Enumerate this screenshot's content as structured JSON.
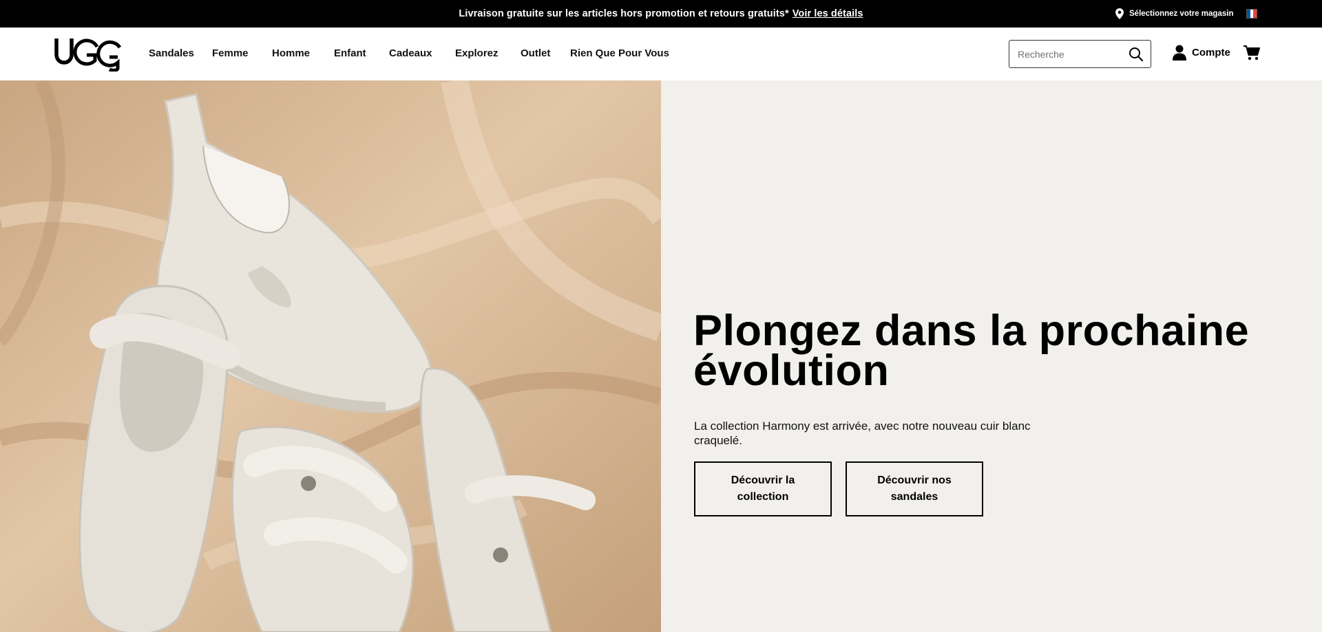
{
  "promo": {
    "message": "Livraison gratuite sur les articles hors promotion et retours gratuits*",
    "link": "Voir les détails",
    "store": "Sélectionnez votre magasin",
    "country_flag_colors": [
      "#0055a4",
      "#ffffff",
      "#ef4135"
    ]
  },
  "header": {
    "brand": "UGG",
    "nav": [
      {
        "label": "Sandales"
      },
      {
        "label": "Femme"
      },
      {
        "label": "Homme"
      },
      {
        "label": "Enfant"
      },
      {
        "label": "Cadeaux"
      },
      {
        "label": "Explorez"
      },
      {
        "label": "Outlet"
      },
      {
        "label": "Rien Que Pour Vous"
      }
    ],
    "search": {
      "placeholder": "Recherche",
      "value": ""
    },
    "account_label": "Compte",
    "icons": [
      "location-pin-icon",
      "search-icon",
      "user-icon",
      "cart-icon"
    ]
  },
  "hero": {
    "image_subject": "white-shoes-on-beige-fabric",
    "headline": "Plongez dans la prochaine évolution",
    "subtext": "La collection Harmony est arrivée, avec notre nouveau cuir blanc craquelé.",
    "buttons": [
      {
        "label": "Découvrir la collection"
      },
      {
        "label": "Découvrir nos sandales"
      }
    ]
  },
  "colors": {
    "promo_bg": "#000000",
    "panel_bg": "#f2f0ed",
    "fabric": "#d9b896",
    "shoe": "#ebe6df"
  }
}
